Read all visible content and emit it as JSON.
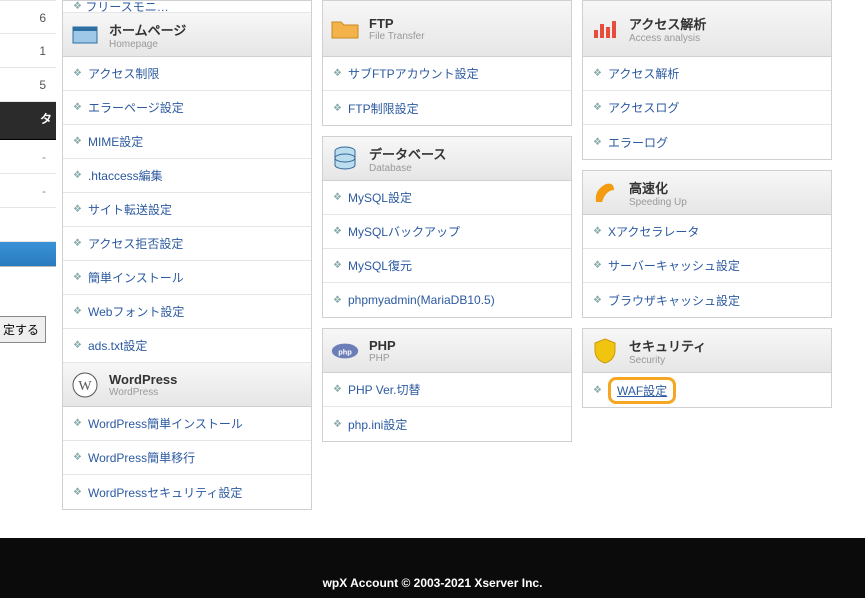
{
  "leftSidebar": {
    "cutoff_item": "フリースモニ…",
    "nums": [
      "6",
      "1",
      "5"
    ],
    "blackbar_label": "タ",
    "dashes": [
      "-",
      "-"
    ],
    "button_label": "定する"
  },
  "columns": {
    "homepage": {
      "title": "ホームページ",
      "subtitle": "Homepage",
      "items": [
        "アクセス制限",
        "エラーページ設定",
        "MIME設定",
        ".htaccess編集",
        "サイト転送設定",
        "アクセス拒否設定",
        "簡単インストール",
        "Webフォント設定",
        "ads.txt設定"
      ]
    },
    "wordpress": {
      "title": "WordPress",
      "subtitle": "WordPress",
      "items": [
        "WordPress簡単インストール",
        "WordPress簡単移行",
        "WordPressセキュリティ設定"
      ]
    },
    "ftp": {
      "title": "FTP",
      "subtitle": "File Transfer",
      "items": [
        "サブFTPアカウント設定",
        "FTP制限設定"
      ]
    },
    "database": {
      "title": "データベース",
      "subtitle": "Database",
      "items": [
        "MySQL設定",
        "MySQLバックアップ",
        "MySQL復元",
        "phpmyadmin(MariaDB10.5)"
      ]
    },
    "php": {
      "title": "PHP",
      "subtitle": "PHP",
      "items": [
        "PHP Ver.切替",
        "php.ini設定"
      ]
    },
    "access": {
      "title": "アクセス解析",
      "subtitle": "Access analysis",
      "items": [
        "アクセス解析",
        "アクセスログ",
        "エラーログ"
      ]
    },
    "speed": {
      "title": "高速化",
      "subtitle": "Speeding Up",
      "items": [
        "Xアクセラレータ",
        "サーバーキャッシュ設定",
        "ブラウザキャッシュ設定"
      ]
    },
    "security": {
      "title": "セキュリティ",
      "subtitle": "Security",
      "items": [
        "WAF設定"
      ]
    }
  },
  "footer": "wpX Account © 2003-2021 Xserver Inc."
}
